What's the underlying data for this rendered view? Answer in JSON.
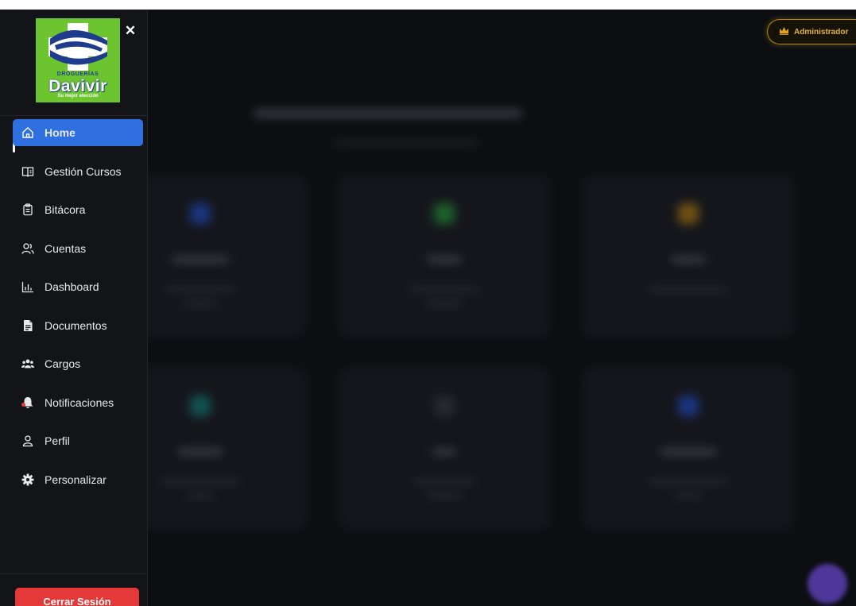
{
  "brand": {
    "small_text": "DROGUERÍAS",
    "name": "Davivir",
    "tagline": "Su mejor elección",
    "color": "#6cc52e"
  },
  "sidebar": {
    "close_icon": "close-icon",
    "items": [
      {
        "label": "Home",
        "icon": "home-icon",
        "active": true
      },
      {
        "label": "Gestión Cursos",
        "icon": "book-icon"
      },
      {
        "label": "Bitácora",
        "icon": "clipboard-icon"
      },
      {
        "label": "Cuentas",
        "icon": "users-icon"
      },
      {
        "label": "Dashboard",
        "icon": "bar-chart-icon"
      },
      {
        "label": "Documentos",
        "icon": "document-icon"
      },
      {
        "label": "Cargos",
        "icon": "group-icon"
      },
      {
        "label": "Notificaciones",
        "icon": "bell-icon",
        "has_unread": true
      },
      {
        "label": "Perfil",
        "icon": "user-icon"
      },
      {
        "label": "Personalizar",
        "icon": "gear-icon"
      }
    ],
    "logout_label": "Cerrar Sesión"
  },
  "header": {
    "role_badge": "Administrador",
    "role_icon": "crown-icon"
  },
  "colors": {
    "active_item": "#2f6fe0",
    "logout": "#e53939",
    "badge_gold": "#e6b13a",
    "notification_dot": "#e53935"
  }
}
